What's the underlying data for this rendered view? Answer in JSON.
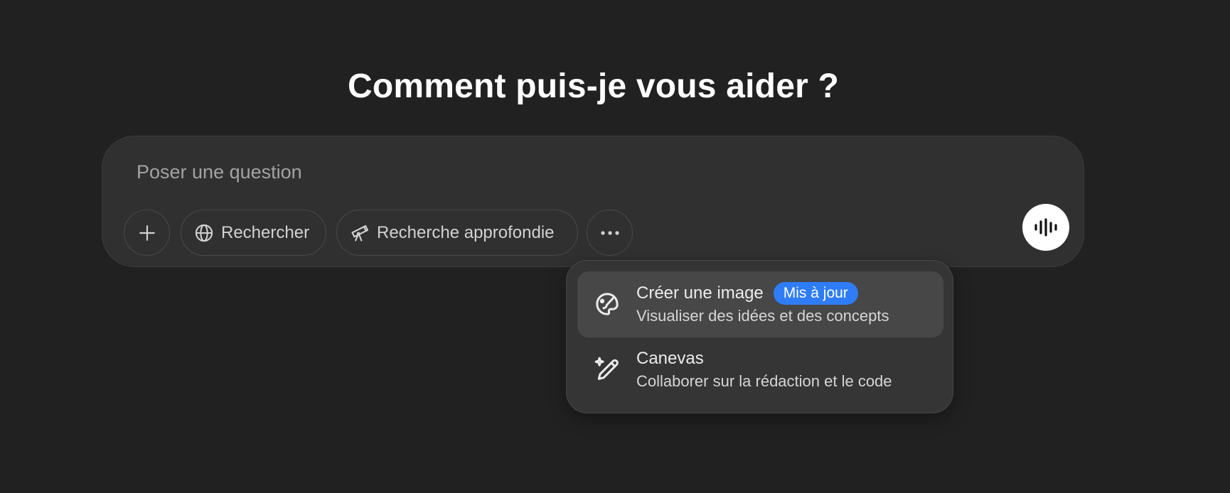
{
  "heading": "Comment puis-je vous aider ?",
  "composer": {
    "placeholder": "Poser une question",
    "value": "",
    "buttons": {
      "attach_icon": "plus-icon",
      "search_label": "Rechercher",
      "search_icon": "globe-icon",
      "deep_research_label": "Recherche approfondie",
      "deep_research_icon": "telescope-icon",
      "more_icon": "ellipsis-icon",
      "voice_icon": "voice-waveform-icon"
    }
  },
  "tools_menu": {
    "items": [
      {
        "icon": "paint-palette-icon",
        "title": "Créer une image",
        "badge": "Mis à jour",
        "description": "Visualiser des idées et des concepts",
        "highlighted": true
      },
      {
        "icon": "sparkle-pencil-icon",
        "title": "Canevas",
        "description": "Collaborer sur la rédaction et le code",
        "highlighted": false
      }
    ]
  },
  "colors": {
    "background": "#212121",
    "composer": "#303030",
    "menu": "#353535",
    "menu_highlight": "#474747",
    "badge": "#2f7df6"
  }
}
